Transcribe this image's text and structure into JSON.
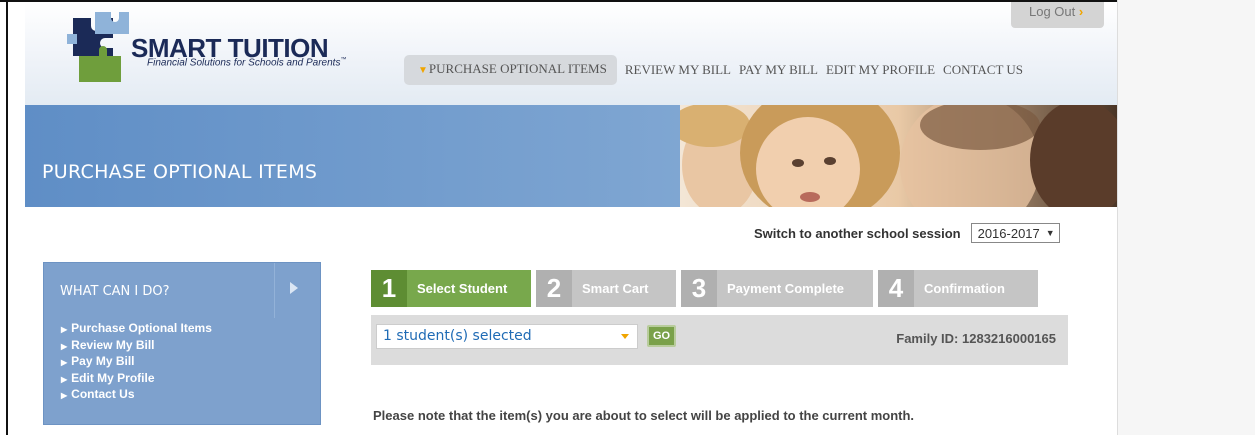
{
  "header": {
    "brand": "SMART TUITION",
    "tagline": "Financial Solutions for Schools and Parents",
    "trademark": "™",
    "logout_label": "Log Out"
  },
  "topnav": {
    "items": [
      {
        "label": "PURCHASE OPTIONAL ITEMS",
        "active": true
      },
      {
        "label": "REVIEW MY BILL"
      },
      {
        "label": "PAY MY BILL"
      },
      {
        "label": "EDIT MY PROFILE"
      },
      {
        "label": "CONTACT US"
      }
    ]
  },
  "banner": {
    "title": "PURCHASE OPTIONAL ITEMS"
  },
  "session": {
    "label": "Switch to another school session",
    "selected": "2016-2017"
  },
  "sidebar": {
    "title": "WHAT CAN I DO?",
    "items": [
      {
        "label": "Purchase Optional Items"
      },
      {
        "label": "Review My Bill"
      },
      {
        "label": "Pay My Bill"
      },
      {
        "label": "Edit My Profile"
      },
      {
        "label": "Contact Us"
      }
    ]
  },
  "steps": [
    {
      "num": "1",
      "label": "Select Student",
      "active": true
    },
    {
      "num": "2",
      "label": "Smart Cart"
    },
    {
      "num": "3",
      "label": "Payment Complete"
    },
    {
      "num": "4",
      "label": "Confirmation"
    }
  ],
  "selector": {
    "students_selected": "1 student(s) selected",
    "go_label": "GO",
    "family_id": "Family ID: 1283216000165"
  },
  "note": "Please note that the item(s) you are about to select will be applied to the current month.",
  "colors": {
    "brand_navy": "#1b2a57",
    "banner_blue": "#6f9acb",
    "step_active_green": "#78a84c",
    "accent_orange": "#f0a500"
  }
}
